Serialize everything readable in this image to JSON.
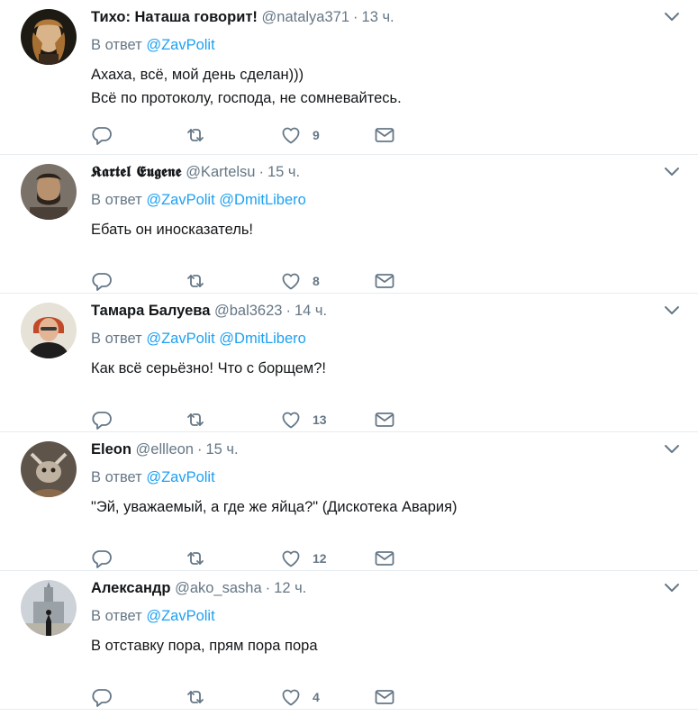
{
  "reply_label": "В ответ",
  "tweets": [
    {
      "fullname": "Тихо: Наташа говорит!",
      "gothic": false,
      "username": "@natalya371",
      "time": "13 ч.",
      "mentions": [
        "@ZavPolit"
      ],
      "lines": [
        "Ахаха, всё, мой день сделан)))",
        "Всё по протоколу, господа, не сомневайтесь."
      ],
      "likes": "9",
      "avatar": "renaissance-portrait"
    },
    {
      "fullname": "𝕶𝖆𝖗𝖙𝖊𝖑 𝕰𝖚𝖌𝖊𝖓𝖊",
      "gothic": true,
      "username": "@Kartelsu",
      "time": "15 ч.",
      "mentions": [
        "@ZavPolit",
        "@DmitLibero"
      ],
      "lines": [
        "Ебать он иносказатель!"
      ],
      "likes": "8",
      "avatar": "bearded-man"
    },
    {
      "fullname": "Тамара Балуева",
      "gothic": false,
      "username": "@bal3623",
      "time": "14 ч.",
      "mentions": [
        "@ZavPolit",
        "@DmitLibero"
      ],
      "lines": [
        "Как всё серьёзно! Что с борщем?!"
      ],
      "likes": "13",
      "avatar": "woman-redhair"
    },
    {
      "fullname": "Eleon",
      "gothic": false,
      "username": "@ellleon",
      "time": "15 ч.",
      "mentions": [
        "@ZavPolit"
      ],
      "lines": [
        "\"Эй, уважаемый, а где же яйца?\" (Дискотека Авария)"
      ],
      "likes": "12",
      "avatar": "cat-photo"
    },
    {
      "fullname": "Александр",
      "gothic": false,
      "username": "@ako_sasha",
      "time": "12 ч.",
      "mentions": [
        "@ZavPolit"
      ],
      "lines": [
        "В отставку пора, прям пора пора"
      ],
      "likes": "4",
      "avatar": "building-silhouette"
    }
  ],
  "colors": {
    "link": "#1da1f2",
    "muted": "#657786",
    "text": "#14171a",
    "divider": "#e6ecf0"
  },
  "icons": {
    "reply": "reply-icon",
    "retweet": "retweet-icon",
    "like": "heart-icon",
    "dm": "envelope-icon",
    "caret": "chevron-down-icon"
  }
}
